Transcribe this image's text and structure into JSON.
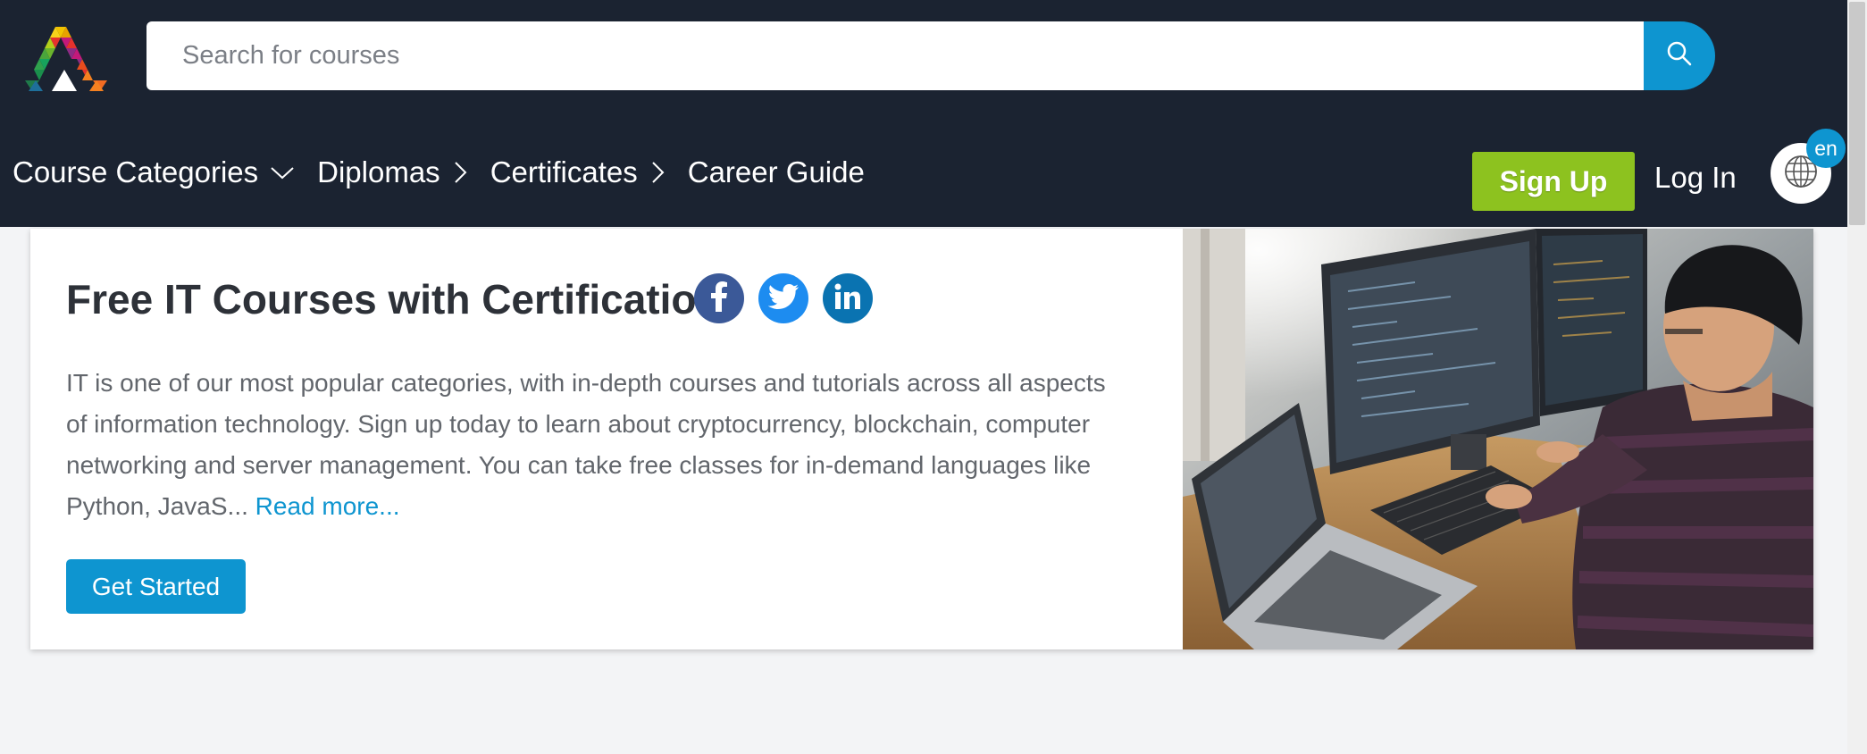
{
  "header": {
    "logo_name": "site-logo",
    "search": {
      "placeholder": "Search for courses",
      "value": ""
    },
    "nav": [
      {
        "label": "Course Categories",
        "chevron": "down"
      },
      {
        "label": "Diplomas",
        "chevron": "right"
      },
      {
        "label": "Certificates",
        "chevron": "right"
      },
      {
        "label": "Career Guide",
        "chevron": "none"
      }
    ],
    "signup_label": "Sign Up",
    "login_label": "Log In",
    "language": "en"
  },
  "hero": {
    "title": "Free IT Courses with Certification",
    "description": "IT is one of our most popular categories, with in-depth courses and tutorials across all aspects of information technology. Sign up today to learn about cryptocurrency, blockchain, computer networking and server management. You can take free classes for in-demand languages like Python, JavaS...",
    "read_more": "Read more...",
    "cta_label": "Get Started",
    "social": [
      "facebook-icon",
      "twitter-icon",
      "linkedin-icon"
    ]
  },
  "colors": {
    "header_bg": "#1b2331",
    "accent_blue": "#0e95d0",
    "signup_green": "#8dc21f",
    "page_bg": "#f3f4f6"
  }
}
